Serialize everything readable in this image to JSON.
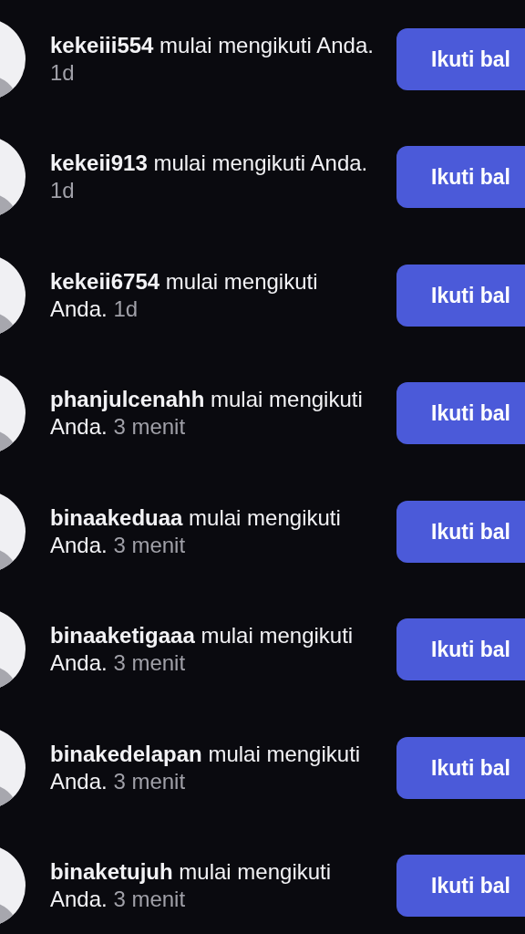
{
  "notifications": [
    {
      "message": "**kekeiii554** mulai mengikuti Anda.",
      "time": "1d",
      "button": "Ikuti bal"
    },
    {
      "message": "**kekeii913** mulai mengikuti Anda.",
      "time": "1d",
      "button": "Ikuti bal"
    },
    {
      "message": "**kekeii6754** mulai mengikuti Anda.",
      "time": "1d",
      "button": "Ikuti bal"
    },
    {
      "message": "**phanjulcenahh** mulai mengikuti Anda.",
      "time": "3 menit",
      "button": "Ikuti bal"
    },
    {
      "message": "**binaakeduaa** mulai mengikuti Anda.",
      "time": "3 menit",
      "button": "Ikuti bal"
    },
    {
      "message": "**binaaketigaaa** mulai mengikuti Anda.",
      "time": "3 menit",
      "button": "Ikuti bal"
    },
    {
      "message": "**binakedelapan** mulai mengikuti Anda.",
      "time": "3 menit",
      "button": "Ikuti bal"
    },
    {
      "message": "**binaketujuh** mulai mengikuti Anda.",
      "time": "3 menit",
      "button": "Ikuti bal"
    }
  ]
}
